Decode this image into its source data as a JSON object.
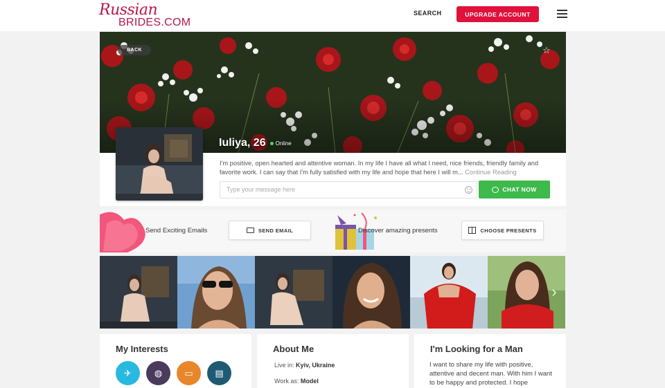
{
  "header": {
    "logo_script": "Russian",
    "logo_domain": "BRIDES.COM",
    "search_label": "SEARCH",
    "upgrade_label": "UPGRADE ACCOUNT",
    "menu_icon": "hamburger-menu-icon"
  },
  "profile": {
    "back_label": "BACK",
    "favorite_icon": "star-icon",
    "name": "Iuliya, 26",
    "status": "Online",
    "bio": "I'm positive, open hearted and attentive woman. In my life I have all what I need, nice friends, friendly family and favorite work. I can say that I'm fully satisfied with my life and hope that here I will m...",
    "continue_label": "Continue Reading",
    "message_placeholder": "Type your message here",
    "chat_label": "CHAT NOW"
  },
  "actions": {
    "emails_text": "Send Exciting Emails",
    "send_email_label": "SEND EMAIL",
    "presents_text": "Discover amazing presents",
    "choose_presents_label": "CHOOSE PRESENTS"
  },
  "gallery": {
    "next_icon": "chevron-right-icon"
  },
  "interests": {
    "title": "My Interests",
    "icons": [
      {
        "name": "travel-icon",
        "color": "#29b8e0"
      },
      {
        "name": "globe-icon",
        "color": "#4a3a5c"
      },
      {
        "name": "tv-icon",
        "color": "#e8862a"
      },
      {
        "name": "cinema-icon",
        "color": "#1f5a73"
      }
    ]
  },
  "about": {
    "title": "About Me",
    "live_label": "Live in:",
    "live_value": "Kyiv, Ukraine",
    "work_label": "Work as:",
    "work_value": "Model"
  },
  "looking": {
    "title": "I'm Looking for a Man",
    "text": "I want to share my life with positive, attentive and decent man. With him I want to be happy and protected. I hope"
  },
  "colors": {
    "brand": "#b8174a",
    "upgrade": "#e0123b",
    "chat": "#3eb94b",
    "online": "#4cd964"
  }
}
